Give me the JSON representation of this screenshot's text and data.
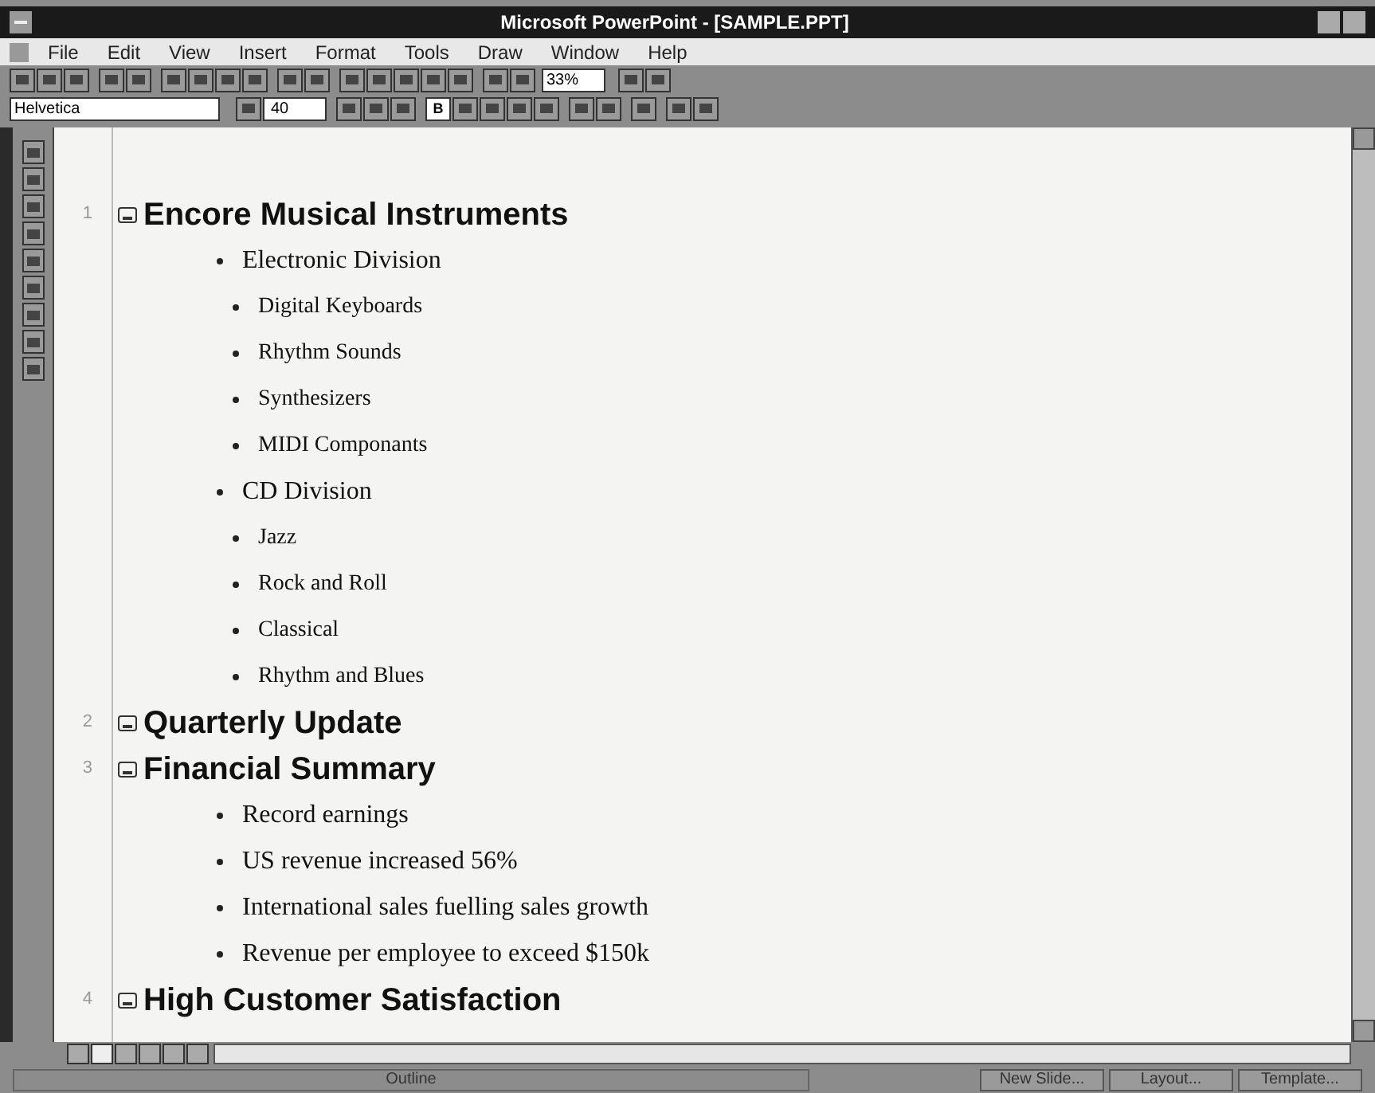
{
  "window": {
    "title": "Microsoft PowerPoint - [SAMPLE.PPT]"
  },
  "menu": [
    "File",
    "Edit",
    "View",
    "Insert",
    "Format",
    "Tools",
    "Draw",
    "Window",
    "Help"
  ],
  "toolbar": {
    "zoom": "33%"
  },
  "format_bar": {
    "font": "Helvetica",
    "size": "40",
    "bold_button": {
      "label": "B",
      "selected": true
    }
  },
  "outline": [
    {
      "number": "1",
      "title": "Encore Musical Instruments",
      "children": [
        {
          "text": "Electronic Division",
          "children": [
            {
              "text": "Digital Keyboards"
            },
            {
              "text": "Rhythm Sounds"
            },
            {
              "text": "Synthesizers"
            },
            {
              "text": "MIDI Componants"
            }
          ]
        },
        {
          "text": "CD Division",
          "children": [
            {
              "text": "Jazz"
            },
            {
              "text": "Rock and Roll"
            },
            {
              "text": "Classical"
            },
            {
              "text": "Rhythm and Blues"
            }
          ]
        }
      ]
    },
    {
      "number": "2",
      "title": "Quarterly Update"
    },
    {
      "number": "3",
      "title": "Financial Summary",
      "children": [
        {
          "text": "Record earnings"
        },
        {
          "text": "US revenue increased 56%"
        },
        {
          "text": "International sales fuelling sales growth"
        },
        {
          "text": "Revenue per employee to exceed $150k"
        }
      ]
    },
    {
      "number": "4",
      "title": "High Customer Satisfaction"
    }
  ],
  "status_bar": [
    "Outline",
    "New Slide...",
    "Layout...",
    "Template..."
  ]
}
